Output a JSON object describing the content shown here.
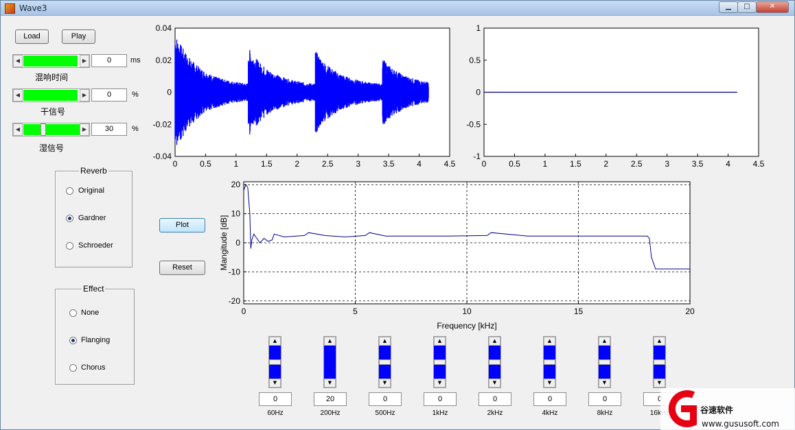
{
  "window": {
    "title": "Wave3",
    "minimize": "▁",
    "maximize": "□",
    "close": "✕"
  },
  "toolbar": {
    "load_label": "Load",
    "play_label": "Play"
  },
  "sliders": [
    {
      "label": "混响时间",
      "value": "0",
      "unit": "ms",
      "level": 0.95
    },
    {
      "label": "干信号",
      "value": "0",
      "unit": "%",
      "level": 0.95
    },
    {
      "label": "湿信号",
      "value": "30",
      "unit": "%",
      "level": 0.3
    }
  ],
  "reverb": {
    "title": "Reverb",
    "options": [
      "Original",
      "Gardner",
      "Schroeder"
    ],
    "selected": 1
  },
  "effect": {
    "title": "Effect",
    "options": [
      "None",
      "Flanging",
      "Chorus"
    ],
    "selected": 1
  },
  "actions": {
    "plot_label": "Plot",
    "reset_label": "Reset"
  },
  "equalizer": {
    "bands": [
      {
        "label": "60Hz",
        "value": "0",
        "level": 0.5
      },
      {
        "label": "200Hz",
        "value": "20",
        "level": 1.0
      },
      {
        "label": "500Hz",
        "value": "0",
        "level": 0.5
      },
      {
        "label": "1kHz",
        "value": "0",
        "level": 0.5
      },
      {
        "label": "2kHz",
        "value": "0",
        "level": 0.5
      },
      {
        "label": "4kHz",
        "value": "0",
        "level": 0.5
      },
      {
        "label": "8kHz",
        "value": "0",
        "level": 0.5
      },
      {
        "label": "16kHz",
        "value": "0",
        "level": 0.5
      }
    ]
  },
  "watermark": {
    "brand": "谷速软件",
    "url": "www.gususoft.com"
  },
  "chart_data": [
    {
      "type": "line",
      "title": "",
      "xlabel": "",
      "ylabel": "",
      "xlim": [
        0,
        4.5
      ],
      "ylim": [
        -0.04,
        0.04
      ],
      "x_ticks": [
        "0",
        "0.5",
        "1",
        "1.5",
        "2",
        "2.5",
        "3",
        "3.5",
        "4",
        "4.5"
      ],
      "y_ticks": [
        "0.04",
        "0.02",
        "0",
        "-0.02",
        "-0.04"
      ],
      "grid": false,
      "color": "#0000ff",
      "bursts": [
        {
          "t0": 0.0,
          "t1": 1.2,
          "peak": 0.033
        },
        {
          "t0": 1.2,
          "t1": 2.3,
          "peak": 0.024
        },
        {
          "t0": 2.3,
          "t1": 3.4,
          "peak": 0.022
        },
        {
          "t0": 3.4,
          "t1": 4.15,
          "peak": 0.017
        }
      ]
    },
    {
      "type": "line",
      "title": "",
      "xlabel": "",
      "ylabel": "",
      "xlim": [
        0,
        4.5
      ],
      "ylim": [
        -1,
        1
      ],
      "x_ticks": [
        "0",
        "0.5",
        "1",
        "1.5",
        "2",
        "2.5",
        "3",
        "3.5",
        "4",
        "4.5"
      ],
      "y_ticks": [
        "1",
        "0.5",
        "0",
        "-0.5",
        "-1"
      ],
      "grid": false,
      "color": "#00008b",
      "x": [
        0,
        4.15
      ],
      "y": [
        0,
        0
      ]
    },
    {
      "type": "line",
      "title": "",
      "xlabel": "Frequency [kHz]",
      "ylabel": "Mangitude [dB]",
      "xlim": [
        0,
        22
      ],
      "ylim": [
        -21,
        21
      ],
      "x_ticks": [
        "0",
        "5",
        "10",
        "15",
        "20"
      ],
      "y_ticks": [
        "20",
        "10",
        "0",
        "-10",
        "-20"
      ],
      "grid": true,
      "color": "#00008b",
      "x": [
        0,
        0.1,
        0.2,
        0.3,
        0.35,
        0.4,
        0.5,
        0.6,
        0.8,
        1.0,
        1.2,
        1.4,
        1.5,
        2.0,
        3.0,
        3.2,
        4.0,
        5.0,
        6.0,
        6.2,
        7.0,
        8.0,
        10.0,
        12.0,
        12.2,
        14.0,
        16.0,
        18.0,
        19.9,
        20.0,
        20.1,
        20.3,
        22.0
      ],
      "y": [
        18,
        20,
        19,
        10,
        -2,
        1,
        3,
        2,
        0,
        1.5,
        0.5,
        1,
        3,
        2,
        2.5,
        3.5,
        2.5,
        2,
        2.5,
        3.5,
        2.3,
        2.3,
        2.3,
        2.5,
        3.5,
        2.3,
        2.3,
        2.3,
        2.3,
        1.5,
        -5,
        -9,
        -9
      ]
    }
  ]
}
